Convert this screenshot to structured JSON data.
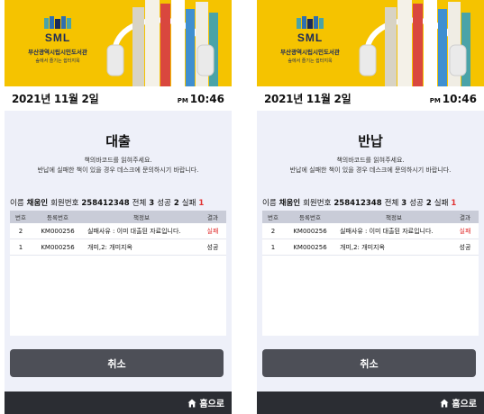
{
  "common": {
    "logo_text": "SML",
    "library_name": "부산광역시립시민도서관",
    "slogan": "숲에서 즐기는 쉼터지옥",
    "date": "2021년 11월 2일",
    "ampm": "PM",
    "time": "10:46",
    "msg_line1": "책의바코드를 읽혀주세요.",
    "msg_line2": "반납에 실패한 책이 있을 경우 데스크에 문의하시기 바랍니다.",
    "name_label": "이름",
    "name_value": "채움인",
    "member_label": "회원번호",
    "member_value": "258412348",
    "total_label": "전체",
    "total_value": "3",
    "success_label": "성공",
    "success_value": "2",
    "fail_label": "실패",
    "fail_value": "1",
    "col_no": "번호",
    "col_reg": "등록번호",
    "col_info": "책정보",
    "col_result": "결과",
    "cancel_label": "취소",
    "home_label": "홈으로"
  },
  "panels": [
    {
      "title": "대출",
      "rows": [
        {
          "no": "2",
          "reg": "KM000256",
          "info": "실패사유 : 이미 대출된 자료입니다.",
          "result": "실패"
        },
        {
          "no": "1",
          "reg": "KM000256",
          "info": "개미,2: 개미지옥",
          "result": "성공"
        }
      ]
    },
    {
      "title": "반납",
      "rows": [
        {
          "no": "2",
          "reg": "KM000256",
          "info": "실패사유 : 이미 대출된 자료입니다.",
          "result": "실패"
        },
        {
          "no": "1",
          "reg": "KM000256",
          "info": "개미,2: 개미지옥",
          "result": "성공"
        }
      ]
    }
  ],
  "colors": {
    "banner": "#f5c300",
    "fail": "#e03131",
    "cancel_button": "#4d4f57",
    "footer": "#2b2d33"
  }
}
